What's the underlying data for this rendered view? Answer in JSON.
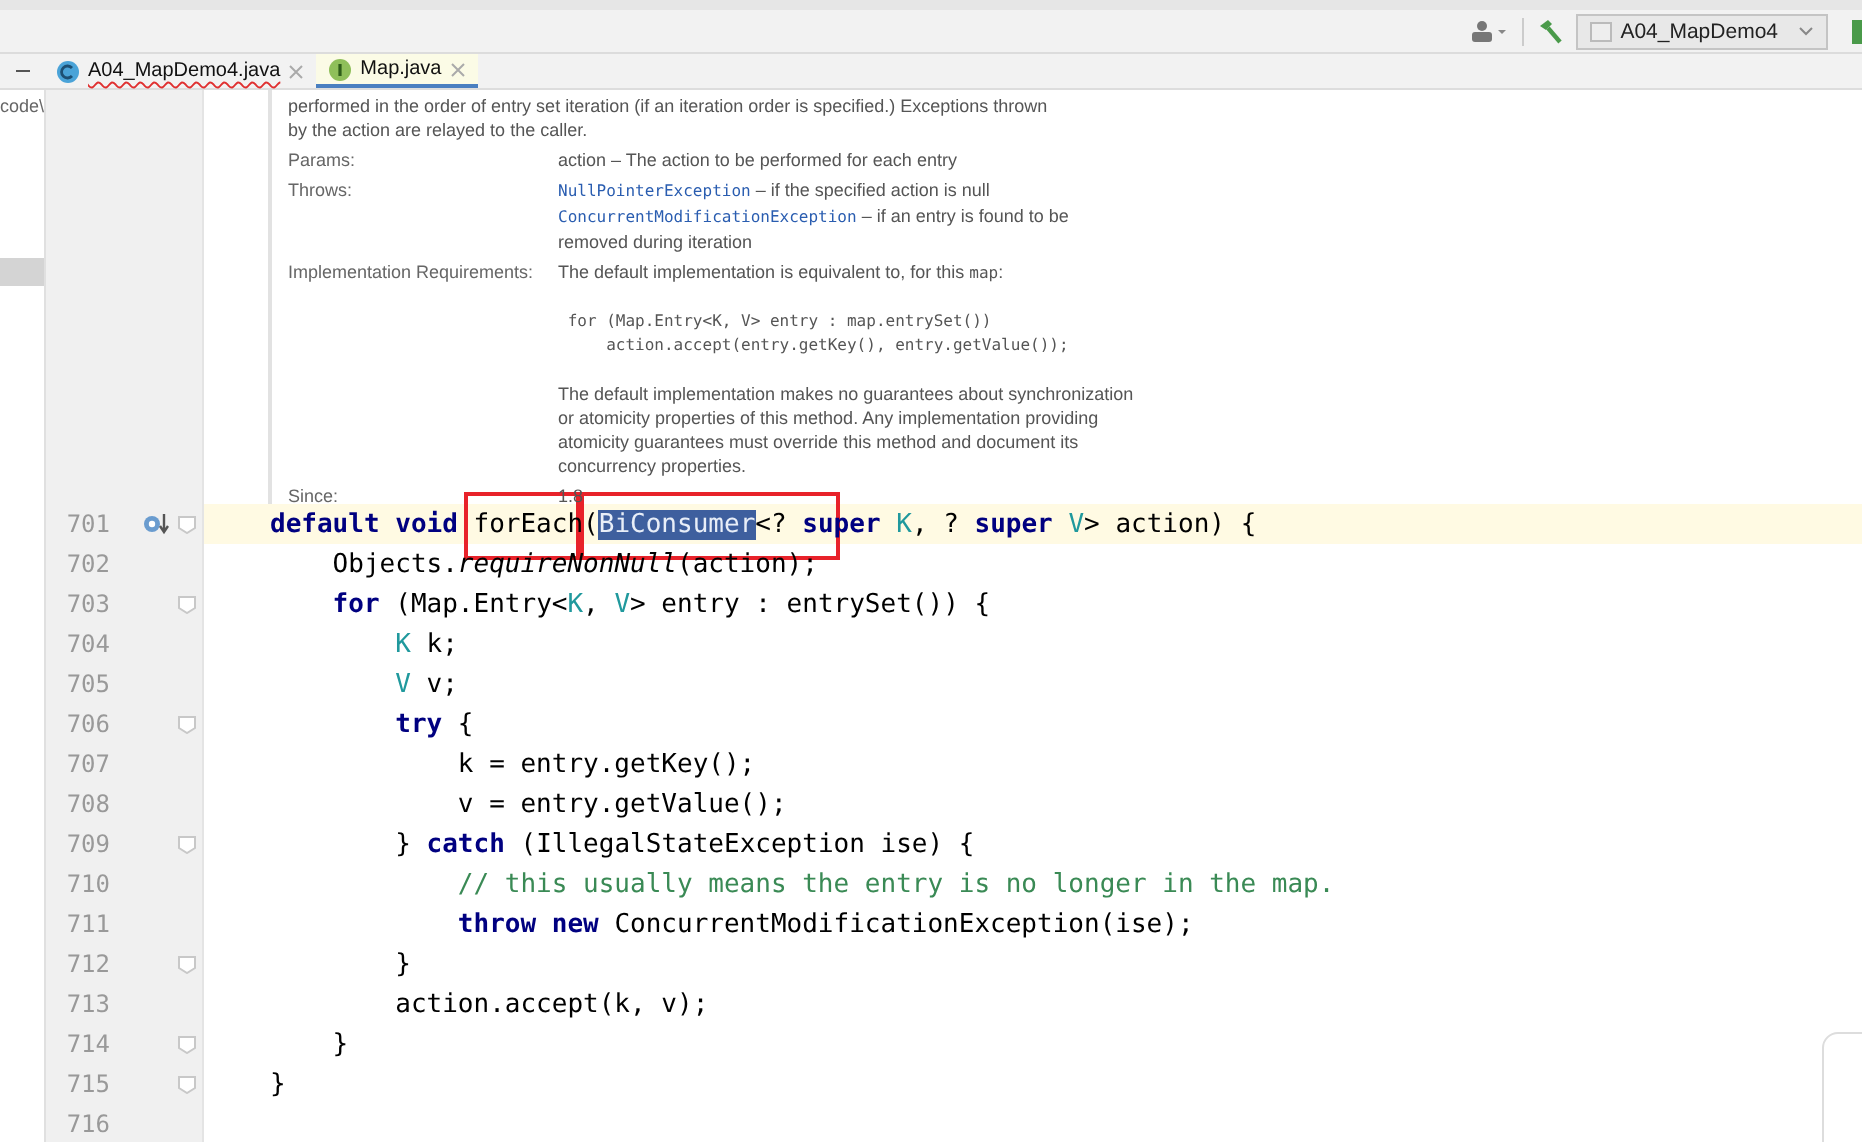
{
  "toolbar": {
    "run_config": "A04_MapDemo4"
  },
  "project_panel": {
    "text": "code\\"
  },
  "tabs": [
    {
      "label": "A04_MapDemo4.java",
      "kind": "class",
      "selected": false
    },
    {
      "label": "Map.java",
      "kind": "interface",
      "selected": true
    }
  ],
  "doc": {
    "intro": [
      "performed in the order of entry set iteration (if an iteration order is specified.) Exceptions thrown",
      "by the action are relayed to the caller."
    ],
    "fields": [
      {
        "label": "Params:",
        "blocks": [
          {
            "kind": "text",
            "text": "action – The action to be performed for each entry"
          }
        ]
      },
      {
        "label": "Throws:",
        "blocks": [
          {
            "kind": "ref",
            "code": "NullPointerException",
            "text": " – if the specified action is null"
          },
          {
            "kind": "ref",
            "code": "ConcurrentModificationException",
            "text": " – if an entry is found to be removed during iteration"
          }
        ]
      },
      {
        "label": "Implementation Requirements:",
        "blocks": [
          {
            "kind": "mixed",
            "text": "The default implementation is equivalent to, for this ",
            "code": "map",
            "tail": ":"
          },
          {
            "kind": "code",
            "lines": [
              " for (Map.Entry<K, V> entry : map.entrySet())",
              "     action.accept(entry.getKey(), entry.getValue());"
            ]
          },
          {
            "kind": "text",
            "text": "The default implementation makes no guarantees about synchronization or atomicity properties of this method. Any implementation providing atomicity guarantees must override this method and document its concurrency properties."
          }
        ]
      },
      {
        "label": "Since:",
        "blocks": [
          {
            "kind": "text",
            "text": "1.8"
          }
        ]
      }
    ]
  },
  "code_lines": [
    {
      "number": "701",
      "current": true,
      "override": true,
      "fold": true,
      "tokens": [
        {
          "kind": "kw",
          "text": "default void "
        },
        {
          "kind": "plain",
          "text": "forEach("
        },
        {
          "kind": "selected",
          "text": "BiConsumer"
        },
        {
          "kind": "plain",
          "text": "<? "
        },
        {
          "kind": "kw",
          "text": "super "
        },
        {
          "kind": "type",
          "text": "K"
        },
        {
          "kind": "plain",
          "text": ", ? "
        },
        {
          "kind": "kw",
          "text": "super "
        },
        {
          "kind": "type",
          "text": "V"
        },
        {
          "kind": "plain",
          "text": "> action) {"
        }
      ]
    },
    {
      "number": "702",
      "current": false,
      "override": false,
      "fold": false,
      "tokens": [
        {
          "kind": "plain",
          "text": "    Objects."
        },
        {
          "kind": "italic",
          "text": "requireNonNull"
        },
        {
          "kind": "plain",
          "text": "(action);"
        }
      ]
    },
    {
      "number": "703",
      "current": false,
      "override": false,
      "fold": true,
      "tokens": [
        {
          "kind": "kw",
          "text": "    for "
        },
        {
          "kind": "plain",
          "text": "(Map.Entry<"
        },
        {
          "kind": "type",
          "text": "K"
        },
        {
          "kind": "plain",
          "text": ", "
        },
        {
          "kind": "type",
          "text": "V"
        },
        {
          "kind": "plain",
          "text": "> entry : entrySet()) {"
        }
      ]
    },
    {
      "number": "704",
      "current": false,
      "override": false,
      "fold": false,
      "tokens": [
        {
          "kind": "type",
          "text": "        K"
        },
        {
          "kind": "plain",
          "text": " k;"
        }
      ]
    },
    {
      "number": "705",
      "current": false,
      "override": false,
      "fold": false,
      "tokens": [
        {
          "kind": "type",
          "text": "        V"
        },
        {
          "kind": "plain",
          "text": " v;"
        }
      ]
    },
    {
      "number": "706",
      "current": false,
      "override": false,
      "fold": true,
      "tokens": [
        {
          "kind": "kw",
          "text": "        try "
        },
        {
          "kind": "plain",
          "text": "{"
        }
      ]
    },
    {
      "number": "707",
      "current": false,
      "override": false,
      "fold": false,
      "tokens": [
        {
          "kind": "plain",
          "text": "            k = entry.getKey();"
        }
      ]
    },
    {
      "number": "708",
      "current": false,
      "override": false,
      "fold": false,
      "tokens": [
        {
          "kind": "plain",
          "text": "            v = entry.getValue();"
        }
      ]
    },
    {
      "number": "709",
      "current": false,
      "override": false,
      "fold": true,
      "tokens": [
        {
          "kind": "plain",
          "text": "        } "
        },
        {
          "kind": "kw",
          "text": "catch "
        },
        {
          "kind": "plain",
          "text": "(IllegalStateException ise) {"
        }
      ]
    },
    {
      "number": "710",
      "current": false,
      "override": false,
      "fold": false,
      "tokens": [
        {
          "kind": "comment",
          "text": "            // this usually means the entry is no longer in the map."
        }
      ]
    },
    {
      "number": "711",
      "current": false,
      "override": false,
      "fold": false,
      "tokens": [
        {
          "kind": "kw",
          "text": "            throw new "
        },
        {
          "kind": "plain",
          "text": "ConcurrentModificationException(ise);"
        }
      ]
    },
    {
      "number": "712",
      "current": false,
      "override": false,
      "fold": true,
      "tokens": [
        {
          "kind": "plain",
          "text": "        }"
        }
      ]
    },
    {
      "number": "713",
      "current": false,
      "override": false,
      "fold": false,
      "tokens": [
        {
          "kind": "plain",
          "text": "        action.accept(k, v);"
        }
      ]
    },
    {
      "number": "714",
      "current": false,
      "override": false,
      "fold": true,
      "tokens": [
        {
          "kind": "plain",
          "text": "    }"
        }
      ]
    },
    {
      "number": "715",
      "current": false,
      "override": false,
      "fold": true,
      "tokens": [
        {
          "kind": "plain",
          "text": "}"
        }
      ]
    },
    {
      "number": "716",
      "current": false,
      "override": false,
      "fold": false
    }
  ]
}
